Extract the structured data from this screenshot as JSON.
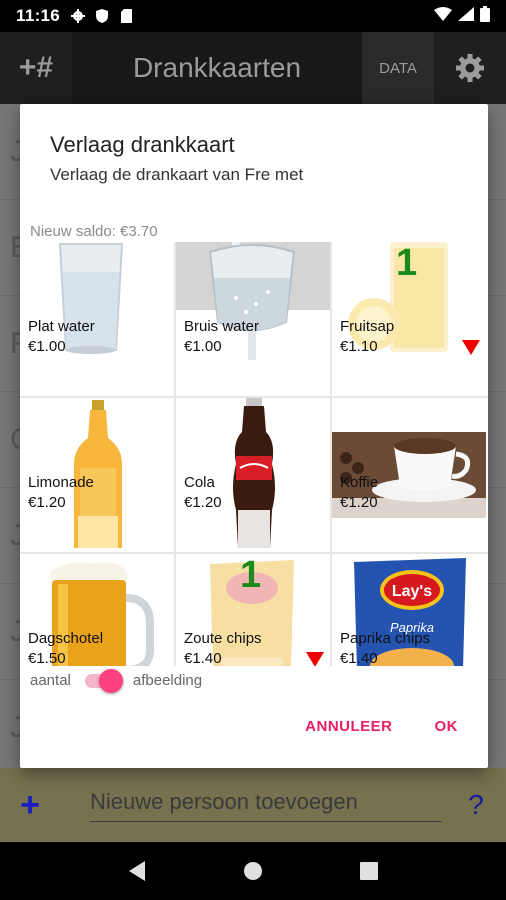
{
  "status_bar": {
    "time": "11:16",
    "icons": [
      "gear-icon",
      "shield-icon",
      "sd-card-icon"
    ],
    "right_icons": [
      "wifi-icon",
      "signal-icon",
      "battery-icon"
    ]
  },
  "app_bar": {
    "hash_button": "+#",
    "title": "Drankkaarten",
    "data_button": "DATA",
    "settings_icon": "gear-icon"
  },
  "background_list": {
    "initials": [
      "J",
      "E",
      "F",
      "G",
      "J",
      "J",
      "J"
    ]
  },
  "add_bar": {
    "plus": "+",
    "placeholder": "Nieuwe persoon toevoegen",
    "help": "?"
  },
  "dialog": {
    "title": "Verlaag drankkaart",
    "subtitle": "Verlaag de drankaart van Fre met",
    "new_balance": "Nieuw saldo: €3.70",
    "items": [
      {
        "name": "Plat water",
        "price": "€1.00"
      },
      {
        "name": "Bruis water",
        "price": "€1.00"
      },
      {
        "name": "Fruitsap",
        "price": "€1.10",
        "count": "1"
      },
      {
        "name": "Limonade",
        "price": "€1.20"
      },
      {
        "name": "Cola",
        "price": "€1.20"
      },
      {
        "name": "Koffie",
        "price": "€1.20"
      },
      {
        "name": "Dagschotel",
        "price": "€1.50"
      },
      {
        "name": "Zoute chips",
        "price": "€1.40",
        "count": "1"
      },
      {
        "name": "Paprika chips",
        "price": "€1.40"
      }
    ],
    "chips_brand": "Lay's",
    "paprika_label": "Paprika",
    "toggle_left": "aantal",
    "toggle_right": "afbeelding",
    "cancel": "ANNULEER",
    "ok": "OK"
  },
  "colors": {
    "accent": "#e91e63",
    "count": "#1a8a1a",
    "decrease": "#e00000"
  }
}
